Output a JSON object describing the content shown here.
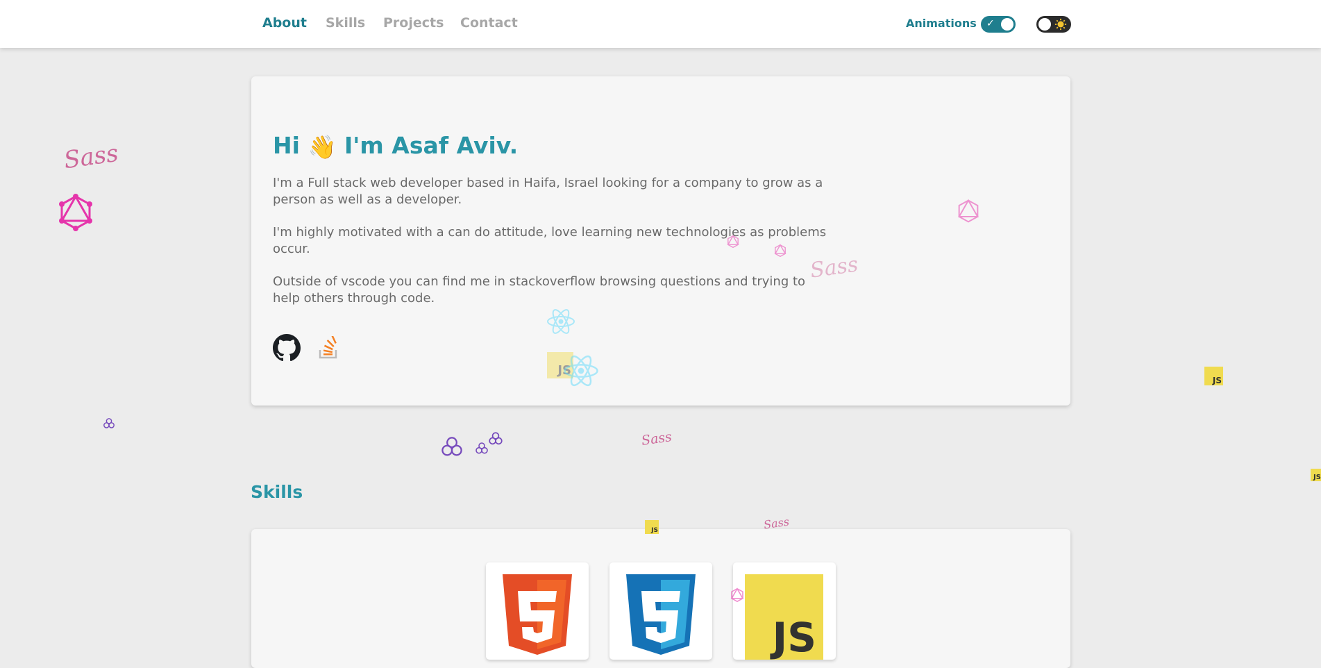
{
  "nav": {
    "links": [
      {
        "label": "About",
        "active": true
      },
      {
        "label": "Skills",
        "active": false
      },
      {
        "label": "Projects",
        "active": false
      },
      {
        "label": "Contact",
        "active": false
      }
    ],
    "animations_label": "Animations",
    "animations_enabled": true,
    "theme": "light"
  },
  "about": {
    "greeting_before": "Hi",
    "wave_emoji": "👋",
    "greeting_after": "I'm Asaf Aviv.",
    "paragraphs": [
      "I'm a Full stack web developer based in Haifa, Israel looking for a company to grow as a person as well as a developer.",
      "I'm highly motivated with a can do attitude, love learning new technologies as problems occur.",
      "Outside of vscode you can find me in stackoverflow browsing questions and trying to help others through code."
    ],
    "social": [
      {
        "name": "github-icon"
      },
      {
        "name": "stackoverflow-icon"
      }
    ]
  },
  "skills": {
    "title": "Skills",
    "items": [
      {
        "name": "html5-icon",
        "label": "5"
      },
      {
        "name": "css3-icon",
        "label": "3"
      },
      {
        "name": "javascript-icon",
        "label": "JS"
      }
    ]
  },
  "decor": {
    "sass_text": "Sass",
    "js_text": "JS"
  },
  "colors": {
    "accent": "#1f7e8e",
    "heading": "#2a95a6",
    "background": "#ececec",
    "card": "#f6f6f6",
    "sass": "#cd6799",
    "graphql": "#e535ab",
    "react": "#61dafb",
    "redux": "#764abc",
    "js": "#f0db4f"
  }
}
